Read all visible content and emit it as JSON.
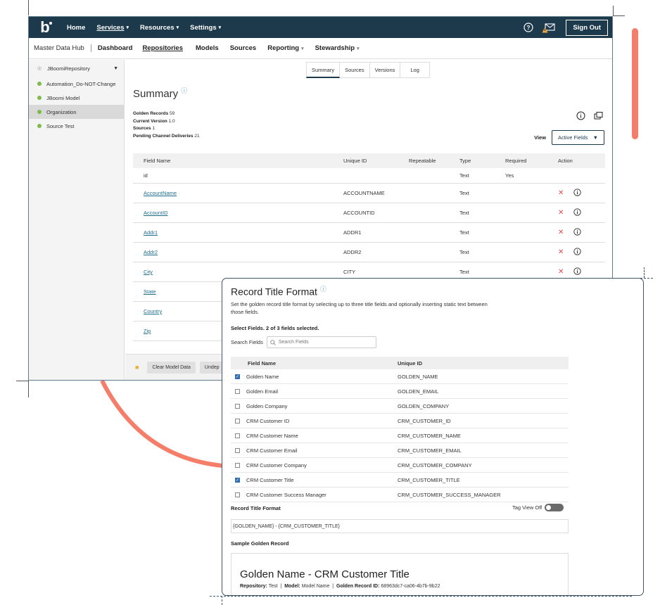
{
  "topbar": {
    "logo": "b",
    "nav": [
      {
        "label": "Home",
        "dropdown": false,
        "active": false
      },
      {
        "label": "Services",
        "dropdown": true,
        "active": true
      },
      {
        "label": "Resources",
        "dropdown": true,
        "active": false
      },
      {
        "label": "Settings",
        "dropdown": true,
        "active": false
      }
    ],
    "sign_out": "Sign Out",
    "icons": [
      "help-icon",
      "notifications-icon",
      "warning-icon"
    ]
  },
  "subnav": {
    "hub": "Master Data Hub",
    "items": [
      {
        "label": "Dashboard",
        "dropdown": false
      },
      {
        "label": "Repositories",
        "dropdown": false,
        "active": true
      },
      {
        "label": "Models",
        "dropdown": false
      },
      {
        "label": "Sources",
        "dropdown": false
      },
      {
        "label": "Reporting",
        "dropdown": true
      },
      {
        "label": "Stewardship",
        "dropdown": true
      }
    ]
  },
  "sidebar": {
    "repository": "JBoomiRepository",
    "items": [
      {
        "label": "Automation_Do-NOT-Change",
        "selected": false
      },
      {
        "label": "JBoomi Model",
        "selected": false
      },
      {
        "label": "Organization",
        "selected": true
      },
      {
        "label": "Source Test",
        "selected": false
      }
    ]
  },
  "tabs": [
    "Summary",
    "Sources",
    "Versions",
    "Log"
  ],
  "summary": {
    "title": "Summary",
    "stats": [
      {
        "label": "Golden Records",
        "value": "59"
      },
      {
        "label": "Current Version",
        "value": "1.0"
      },
      {
        "label": "Sources",
        "value": "1"
      },
      {
        "label": "Pending Channel Deliveries",
        "value": "21"
      }
    ],
    "view_label": "View",
    "view_value": "Active Fields"
  },
  "fields_table": {
    "headers": [
      "Field Name",
      "Unique ID",
      "Repeatable",
      "Type",
      "Required",
      "Action"
    ],
    "rows": [
      {
        "name": "id",
        "uid": "",
        "repeatable": "",
        "type": "Text",
        "required": "Yes",
        "link": false,
        "actions": false
      },
      {
        "name": "AccountName",
        "uid": "ACCOUNTNAME",
        "repeatable": "",
        "type": "Text",
        "required": "",
        "link": true,
        "actions": true
      },
      {
        "name": "AccountID",
        "uid": "ACCOUNTID",
        "repeatable": "",
        "type": "Text",
        "required": "",
        "link": true,
        "actions": true
      },
      {
        "name": "Addr1",
        "uid": "ADDR1",
        "repeatable": "",
        "type": "Text",
        "required": "",
        "link": true,
        "actions": true
      },
      {
        "name": "Addr2",
        "uid": "ADDR2",
        "repeatable": "",
        "type": "Text",
        "required": "",
        "link": true,
        "actions": true
      },
      {
        "name": "City",
        "uid": "CITY",
        "repeatable": "",
        "type": "Text",
        "required": "",
        "link": true,
        "actions": true
      },
      {
        "name": "State",
        "uid": "",
        "repeatable": "",
        "type": "",
        "required": "",
        "link": true,
        "actions": false
      },
      {
        "name": "Country",
        "uid": "",
        "repeatable": "",
        "type": "",
        "required": "",
        "link": true,
        "actions": false
      },
      {
        "name": "Zip",
        "uid": "",
        "repeatable": "",
        "type": "",
        "required": "",
        "link": true,
        "actions": false
      }
    ]
  },
  "bottom_bar": {
    "buttons": [
      "Clear Model Data",
      "Undep"
    ]
  },
  "modal": {
    "title": "Record Title Format",
    "description": "Set the golden record title format by selecting up to three title fields and optionally inserting static text between those fields.",
    "selected_text": "Select Fields. 2 of 3 fields selected.",
    "search_label": "Search Fields",
    "search_placeholder": "Search Fields",
    "headers": [
      "Field Name",
      "Unique ID"
    ],
    "rows": [
      {
        "name": "Golden Name",
        "uid": "GOLDEN_NAME",
        "checked": true
      },
      {
        "name": "Golden Email",
        "uid": "GOLDEN_EMAIL",
        "checked": false
      },
      {
        "name": "Golden Company",
        "uid": "GOLDEN_COMPANY",
        "checked": false
      },
      {
        "name": "CRM Customer ID",
        "uid": "CRM_CUSTOMER_ID",
        "checked": false
      },
      {
        "name": "CRM Customer Name",
        "uid": "CRM_CUSTOMER_NAME",
        "checked": false
      },
      {
        "name": "CRM Customer Email",
        "uid": "CRM_CUSTOMER_EMAIL",
        "checked": false
      },
      {
        "name": "CRM Customer Company",
        "uid": "CRM_CUSTOMER_COMPANY",
        "checked": false
      },
      {
        "name": "CRM Customer Title",
        "uid": "CRM_CUSTOMER_TITLE",
        "checked": true
      },
      {
        "name": "CRM Customer Success Manager",
        "uid": "CRM_CUSTOMER_SUCCESS_MANAGER",
        "checked": false
      }
    ],
    "format_label": "Record Title Format",
    "tag_view_label": "Tag View Off",
    "tag_view_on": false,
    "format_value": "{GOLDEN_NAME} - {CRM_CUSTOMER_TITLE}",
    "sample_label": "Sample Golden Record",
    "sample_title": "Golden Name - CRM Customer Title",
    "sample_meta": [
      {
        "label": "Repository:",
        "value": "Test"
      },
      {
        "label": "Model:",
        "value": "Model Name"
      },
      {
        "label": "Golden Record ID:",
        "value": "68963dc7-ca06-4b7b-9b22"
      }
    ]
  },
  "colors": {
    "nav_bg": "#1d3a4c",
    "accent_coral": "#f47e6a",
    "link": "#1f6e8c",
    "status_green": "#7dbb4b",
    "delete_red": "#e04a4a",
    "checkbox_blue": "#2e6fb3"
  }
}
